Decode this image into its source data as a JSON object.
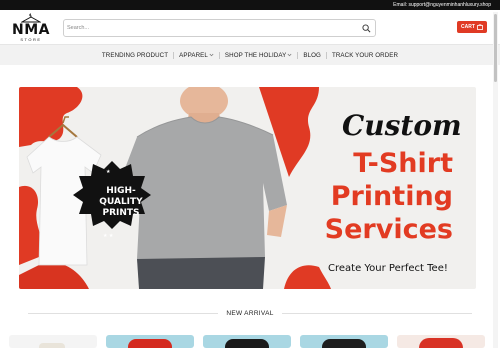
{
  "topbar": {
    "email_text": "Email: support@nguyenminhanhluxury.shop"
  },
  "logo": {
    "name": "NMA",
    "sub": "STORE"
  },
  "search": {
    "placeholder": "Search..."
  },
  "cart": {
    "label": "CART"
  },
  "nav": {
    "items": [
      {
        "label": "TRENDING PRODUCT",
        "has_dropdown": false
      },
      {
        "label": "APPAREL",
        "has_dropdown": true
      },
      {
        "label": "SHOP THE HOLIDAY",
        "has_dropdown": true
      },
      {
        "label": "BLOG",
        "has_dropdown": false
      },
      {
        "label": "TRACK YOUR ORDER",
        "has_dropdown": false
      }
    ]
  },
  "hero": {
    "custom": "Custom",
    "headline_line1": "T-Shirt",
    "headline_line2": "Printing",
    "headline_line3": "Services",
    "tagline": "Create Your Perfect Tee!",
    "badge_line1": "HIGH-",
    "badge_line2": "QUALITY",
    "badge_line3": "PRINTS"
  },
  "section": {
    "title": "NEW ARRIVAL"
  },
  "colors": {
    "accent": "#e03a24",
    "topbar": "#111111",
    "nav_bg": "#f2f2f2"
  }
}
